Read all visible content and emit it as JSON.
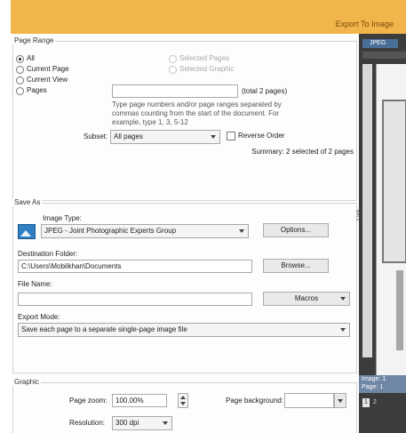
{
  "window": {
    "title": "Export To Image"
  },
  "page_range": {
    "legend": "Page Range",
    "all": "All",
    "current_page": "Current Page",
    "current_view": "Current View",
    "pages": "Pages",
    "selected_pages": "Selected Pages",
    "selected_graphic": "Selected Graphic",
    "pages_value": "",
    "total_pages": "(total 2 pages)",
    "hint": "Type page numbers and/or page ranges separated by\ncommas counting from the start of the document. For\nexample, type 1, 3, 5-12",
    "subset_label": "Subset:",
    "subset_value": "All pages",
    "reverse_order": "Reverse Order",
    "summary": "Summary: 2 selected of 2 pages",
    "selected": "all"
  },
  "save_as": {
    "legend": "Save As",
    "image_type_label": "Image Type:",
    "image_type_value": "JPEG - Joint Photographic Experts Group",
    "options_button": "Options...",
    "destination_label": "Destination Folder:",
    "destination_value": "C:\\Users\\Mobilkhan\\Documents",
    "browse_button": "Browse...",
    "file_name_label": "File Name:",
    "file_name_value": "",
    "macros_button": "Macros",
    "export_mode_label": "Export Mode:",
    "export_mode_value": "Save each page to a separate single-page image file"
  },
  "graphic": {
    "legend": "Graphic",
    "page_zoom_label": "Page zoom:",
    "page_zoom_value": "100.00%",
    "page_background_label": "Page background:",
    "resolution_label": "Resolution:",
    "resolution_value": "300 dpi"
  },
  "preview_panel": {
    "tab": "JPEG",
    "side_label": "Link",
    "image_info_1": "Image: 1",
    "image_info_2": "Page: 1",
    "page_number": "1",
    "page_count": "2"
  },
  "colors": {
    "titlebar": "#f2b54b",
    "side_panel": "#3c3c3c",
    "preview_header": "#4a6f98",
    "info_bar": "#6f86a4"
  },
  "icons": {
    "image_type": "picture-icon",
    "spin": "spinner-arrows-icon",
    "dropdown": "chevron-down-icon"
  }
}
